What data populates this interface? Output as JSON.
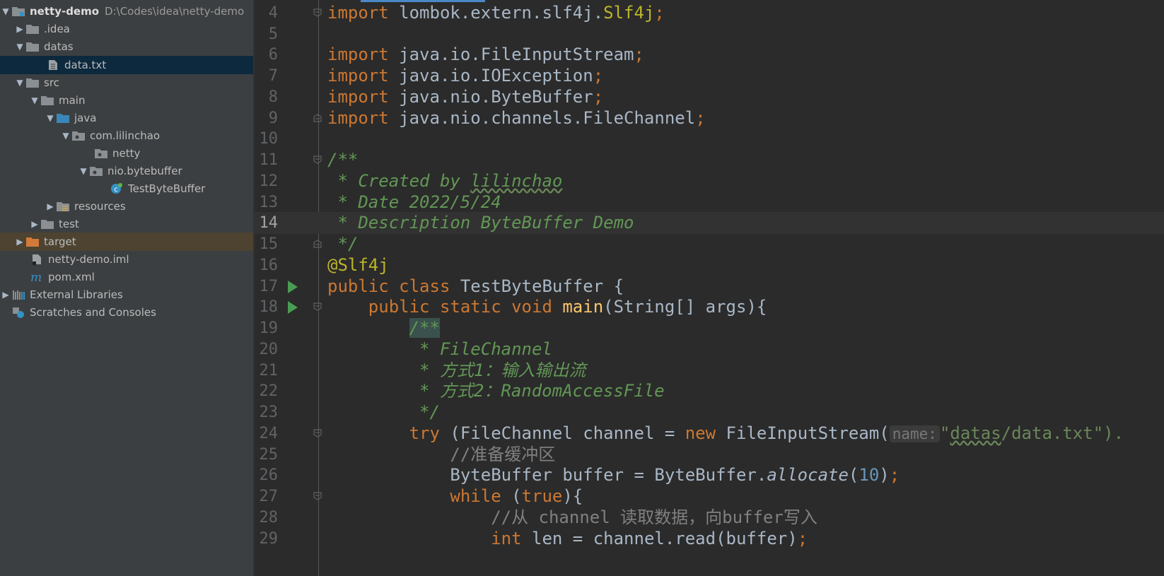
{
  "sidebar": {
    "root": {
      "label": "netty-demo",
      "path": "D:\\Codes\\idea\\netty-demo"
    },
    "items": [
      {
        "label": ".idea"
      },
      {
        "label": "datas"
      },
      {
        "label": "data.txt"
      },
      {
        "label": "src"
      },
      {
        "label": "main"
      },
      {
        "label": "java"
      },
      {
        "label": "com.lilinchao"
      },
      {
        "label": "netty"
      },
      {
        "label": "nio.bytebuffer"
      },
      {
        "label": "TestByteBuffer"
      },
      {
        "label": "resources"
      },
      {
        "label": "test"
      },
      {
        "label": "target"
      },
      {
        "label": "netty-demo.iml"
      },
      {
        "label": "pom.xml"
      },
      {
        "label": "External Libraries"
      },
      {
        "label": "Scratches and Consoles"
      }
    ]
  },
  "editor": {
    "lines": [
      {
        "n": "4",
        "t": [
          "import",
          " lombok.extern.slf4j.",
          "Slf4j",
          ";"
        ]
      },
      {
        "n": "5",
        "t": []
      },
      {
        "n": "6",
        "t": [
          "import",
          " java.io.FileInputStream",
          ";"
        ]
      },
      {
        "n": "7",
        "t": [
          "import",
          " java.io.IOException",
          ";"
        ]
      },
      {
        "n": "8",
        "t": [
          "import",
          " java.nio.ByteBuffer",
          ";"
        ]
      },
      {
        "n": "9",
        "t": [
          "import",
          " java.nio.channels.FileChannel",
          ";"
        ]
      },
      {
        "n": "10",
        "t": []
      },
      {
        "n": "11",
        "t": [
          "/**"
        ]
      },
      {
        "n": "12",
        "t": [
          " * Created by ",
          "lilinchao"
        ]
      },
      {
        "n": "13",
        "t": [
          " * Date 2022/5/24"
        ]
      },
      {
        "n": "14",
        "t": [
          " * Description ByteBuffer Demo"
        ]
      },
      {
        "n": "15",
        "t": [
          " */"
        ]
      },
      {
        "n": "16",
        "t": [
          "@Slf4j"
        ]
      },
      {
        "n": "17",
        "t": [
          "public",
          " ",
          "class",
          " TestByteBuffer {"
        ]
      },
      {
        "n": "18",
        "t": [
          "    ",
          "public",
          " ",
          "static",
          " ",
          "void",
          " ",
          "main",
          "(String[] args){"
        ]
      },
      {
        "n": "19",
        "t": [
          "        ",
          "/**"
        ]
      },
      {
        "n": "20",
        "t": [
          "         * FileChannel"
        ]
      },
      {
        "n": "21",
        "t": [
          "         * 方式1：输入输出流"
        ]
      },
      {
        "n": "22",
        "t": [
          "         * 方式2：RandomAccessFile"
        ]
      },
      {
        "n": "23",
        "t": [
          "         */"
        ]
      },
      {
        "n": "24",
        "t": [
          "        ",
          "try",
          " (FileChannel channel = ",
          "new",
          " FileInputStream(",
          "name:",
          "\"",
          "datas",
          "/data.txt\")."
        ]
      },
      {
        "n": "25",
        "t": [
          "            //准备缓冲区"
        ]
      },
      {
        "n": "26",
        "t": [
          "            ByteBuffer buffer = ByteBuffer.",
          "allocate",
          "(",
          "10",
          ")",
          ";"
        ]
      },
      {
        "n": "27",
        "t": [
          "            ",
          "while",
          " (",
          "true",
          "){"
        ]
      },
      {
        "n": "28",
        "t": [
          "                //从 channel 读取数据，向buffer写入"
        ]
      },
      {
        "n": "29",
        "t": [
          "                ",
          "int",
          " len = channel.read(buffer)",
          ";"
        ]
      }
    ]
  },
  "colors": {
    "sidebar_bg": "#3c3f41",
    "editor_bg": "#2b2b2b",
    "selection": "#0d293e",
    "keyword": "#cc7832",
    "comment": "#629755"
  }
}
